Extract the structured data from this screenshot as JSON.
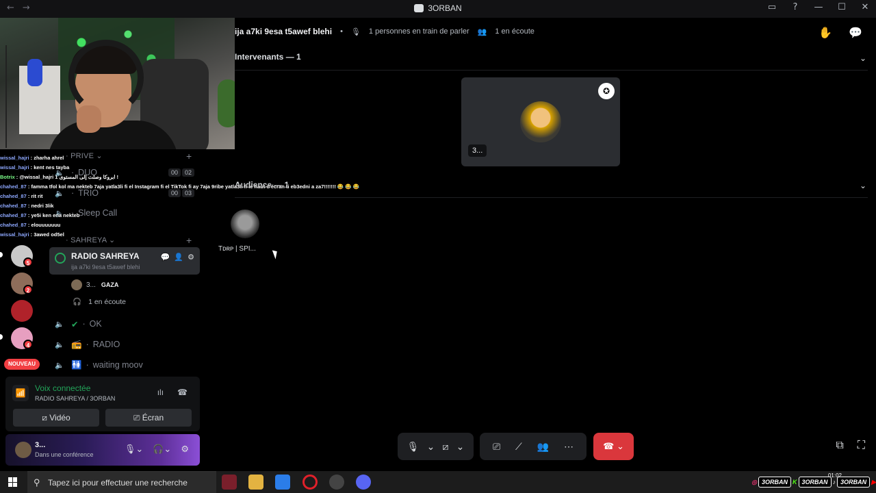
{
  "window": {
    "title": "3ORBAN"
  },
  "chat": [
    {
      "user": "wissal_hajri",
      "msg": " : zharha ahrel"
    },
    {
      "user": "wissal_hajri",
      "msg": " : kent nes tayba"
    },
    {
      "user": "Botrix",
      "msg": " : @wissal_hajri ابروكا وصلت إلى المستوى 1 !"
    },
    {
      "user": "chahed_87",
      "msg": " : famma tfol kol ma nekteb 7aja yatla3li fi el Instagram fi el TikTok fi ay 7aja 9ribe yatla3li fi le haut d'écran ti eb3edni a za7!!!!!!! 😂 😂 😂"
    },
    {
      "user": "chahed_87",
      "msg": " : rit rit"
    },
    {
      "user": "chahed_87",
      "msg": " : nedri 3lik"
    },
    {
      "user": "chahed_87",
      "msg": " : ye5i ken ena nekteb"
    },
    {
      "user": "chahed_87",
      "msg": " : elouuuuuuu"
    },
    {
      "user": "wissal_hajri",
      "msg": " : 3awed od5el"
    }
  ],
  "rail": {
    "badges": [
      "5",
      "2",
      "4"
    ],
    "nouveau": "NOUVEAU"
  },
  "channels": {
    "cat_prive": "PRIVE",
    "duo": {
      "name": "DUO",
      "c1": "00",
      "c2": "02"
    },
    "trio": {
      "name": "TRIO",
      "c1": "00",
      "c2": "03"
    },
    "sleep": "Sleep Call",
    "cat_sahreya": "SAHREYA",
    "radio": {
      "name": "RADIO SAHREYA",
      "topic": "ija a7ki 9esa t5awef blehi"
    },
    "member": {
      "name": "3...",
      "tag": "GAZA"
    },
    "listening": "1 en écoute",
    "ok": "OK",
    "radio2": "RADIO",
    "waiting": "waiting moov"
  },
  "voice": {
    "status": "Voix connectée",
    "location": "RADIO SAHREYA / 3ORBAN",
    "video": "Vidéo",
    "screen": "Écran"
  },
  "user": {
    "name": "3...",
    "status": "Dans une conférence"
  },
  "stage": {
    "topic": "ija a7ki 9esa t5awef blehi",
    "speaking": "1 personnes en train de parler",
    "listening": "1 en écoute",
    "speakers_header": "Intervenants — 1",
    "audience_header": "Audience — 1",
    "speaker_name": "3...",
    "audience_name": "Tᴅʀᴘ | SPI..."
  },
  "taskbar": {
    "search_placeholder": "Tapez ici pour effectuer une recherche",
    "clock": "01:02",
    "tray_labels": [
      "3ORBAN",
      "3ORBAN",
      "3ORBAN"
    ]
  },
  "colors": {
    "accent_green": "#23a55a",
    "danger": "#da373c",
    "badge": "#f23f43"
  }
}
